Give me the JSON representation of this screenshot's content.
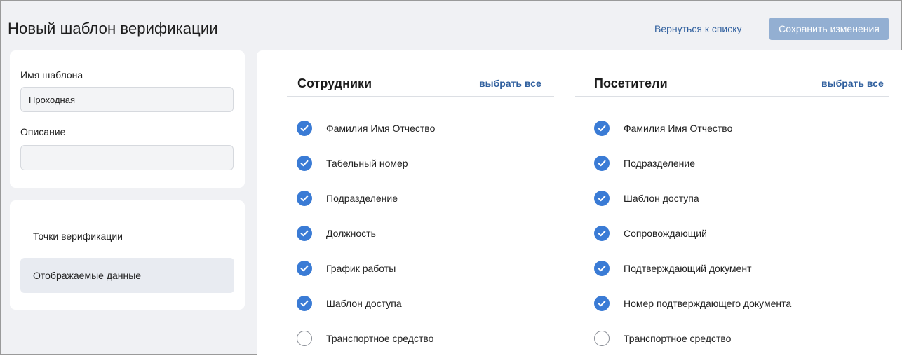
{
  "header": {
    "title": "Новый шаблон верификации",
    "back_label": "Вернуться к списку",
    "save_label": "Сохранить изменения"
  },
  "form": {
    "name_label": "Имя шаблона",
    "name_value": "Проходная",
    "description_label": "Описание",
    "description_value": ""
  },
  "nav": {
    "items": [
      {
        "label": "Точки верификации",
        "active": false
      },
      {
        "label": "Отображаемые данные",
        "active": true
      }
    ]
  },
  "employees": {
    "title": "Сотрудники",
    "select_all": "выбрать все",
    "options": [
      {
        "label": "Фамилия Имя Отчество",
        "checked": true
      },
      {
        "label": "Табельный номер",
        "checked": true
      },
      {
        "label": "Подразделение",
        "checked": true
      },
      {
        "label": "Должность",
        "checked": true
      },
      {
        "label": "График работы",
        "checked": true
      },
      {
        "label": "Шаблон доступа",
        "checked": true
      },
      {
        "label": "Транспортное средство",
        "checked": false
      }
    ]
  },
  "visitors": {
    "title": "Посетители",
    "select_all": "выбрать все",
    "options": [
      {
        "label": "Фамилия Имя Отчество",
        "checked": true
      },
      {
        "label": "Подразделение",
        "checked": true
      },
      {
        "label": "Шаблон доступа",
        "checked": true
      },
      {
        "label": "Сопровождающий",
        "checked": true
      },
      {
        "label": "Подтверждающий документ",
        "checked": true
      },
      {
        "label": "Номер подтверждающего документа",
        "checked": true
      },
      {
        "label": "Транспортное средство",
        "checked": false
      }
    ]
  },
  "colors": {
    "accent": "#3a7bd5",
    "link": "#2f5f9e",
    "save_button": "#93afd2",
    "page_background": "#f0f1f4"
  }
}
